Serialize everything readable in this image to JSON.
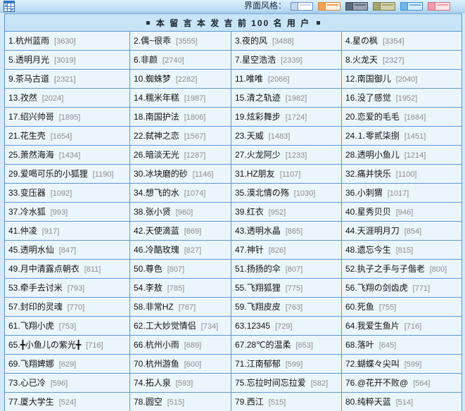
{
  "theme": {
    "page_bg": "#d4e9f8",
    "topbar_top": "#dff0fc",
    "topbar_bottom": "#b3d7f2",
    "topbar_line": "#8dbbe2",
    "grid": "#5b99d3",
    "header_bg": "#c8e4f6",
    "cell_bg": "#ebf5fc",
    "text": "#111111",
    "count": "#8c8c8c"
  },
  "topbar": {
    "icon": "window-grid-icon",
    "style_label": "界面风格：",
    "swatches": [
      {
        "border": "#6f8fbf",
        "a": "#c5d6ea",
        "b": "#ffffff"
      },
      {
        "border": "#d88a3c",
        "a": "#f6a150",
        "b": "#fdf0e2"
      },
      {
        "border": "#3f4a5a",
        "a": "#5e6a7c",
        "b": "#9aa3b2"
      },
      {
        "border": "#7f7d4e",
        "a": "#a6a46c",
        "b": "#d2d0a8"
      },
      {
        "border": "#3d8fd0",
        "a": "#6fb6e8",
        "b": "#d5ecfb"
      },
      {
        "border": "#d36b7c",
        "a": "#f29aa8",
        "b": "#fde6ea"
      }
    ]
  },
  "board": {
    "title": "本 留 言 本 发 言 前 100 名 用 户",
    "title_bullet_icon": "square-bullet-icon",
    "users": [
      {
        "rank": "1.",
        "name": "杭州蓝雨",
        "count": "[3630]"
      },
      {
        "rank": "2.",
        "name": "偶~很乖",
        "count": "[3555]"
      },
      {
        "rank": "3.",
        "name": "夜的风",
        "count": "[3488]"
      },
      {
        "rank": "4.",
        "name": "星の枫",
        "count": "[3354]"
      },
      {
        "rank": "5.",
        "name": "透明月光",
        "count": "[3019]"
      },
      {
        "rank": "6.",
        "name": "非颜",
        "count": "[2740]"
      },
      {
        "rank": "7.",
        "name": "星空浩浩",
        "count": "[2339]"
      },
      {
        "rank": "8.",
        "name": "火龙天",
        "count": "[2327]"
      },
      {
        "rank": "9.",
        "name": "茶马古道",
        "count": "[2321]"
      },
      {
        "rank": "10.",
        "name": "蜘蛛梦",
        "count": "[2282]"
      },
      {
        "rank": "11.",
        "name": "唯唯",
        "count": "[2066]"
      },
      {
        "rank": "12.",
        "name": "南国御儿",
        "count": "[2040]"
      },
      {
        "rank": "13.",
        "name": "孜然",
        "count": "[2024]"
      },
      {
        "rank": "14.",
        "name": "糯米年糕",
        "count": "[1987]"
      },
      {
        "rank": "15.",
        "name": "清之轨迹",
        "count": "[1982]"
      },
      {
        "rank": "16.",
        "name": "没了感觉",
        "count": "[1952]"
      },
      {
        "rank": "17.",
        "name": "绍兴帅哥",
        "count": "[1895]"
      },
      {
        "rank": "18.",
        "name": "南国护法",
        "count": "[1806]"
      },
      {
        "rank": "19.",
        "name": "炫彩舞步",
        "count": "[1724]"
      },
      {
        "rank": "20.",
        "name": "恋爱的毛毛",
        "count": "[1684]"
      },
      {
        "rank": "21.",
        "name": "花生壳",
        "count": "[1654]"
      },
      {
        "rank": "22.",
        "name": "弑神之恋",
        "count": "[1567]"
      },
      {
        "rank": "23.",
        "name": "天威",
        "count": "[1483]"
      },
      {
        "rank": "24.",
        "name": "⒈零贰柒捌",
        "count": "[1451]"
      },
      {
        "rank": "25.",
        "name": "萧然海海",
        "count": "[1434]"
      },
      {
        "rank": "26.",
        "name": "暗淡无光",
        "count": "[1287]"
      },
      {
        "rank": "27.",
        "name": "火龙阿少",
        "count": "[1233]"
      },
      {
        "rank": "28.",
        "name": "透明小鱼儿",
        "count": "[1214]"
      },
      {
        "rank": "29.",
        "name": "爱喝可乐的小狐狸",
        "count": "[1190]"
      },
      {
        "rank": "30.",
        "name": "冰块磨的砂",
        "count": "[1146]"
      },
      {
        "rank": "31.",
        "name": "HZ朋友",
        "count": "[1107]"
      },
      {
        "rank": "32.",
        "name": "痛并快乐",
        "count": "[1100]"
      },
      {
        "rank": "33.",
        "name": "变压器",
        "count": "[1092]"
      },
      {
        "rank": "34.",
        "name": "想飞的水",
        "count": "[1074]"
      },
      {
        "rank": "35.",
        "name": "漠北情の殇",
        "count": "[1030]"
      },
      {
        "rank": "36.",
        "name": "小刺猬",
        "count": "[1017]"
      },
      {
        "rank": "37.",
        "name": "冷水狐",
        "count": "[993]"
      },
      {
        "rank": "38.",
        "name": "张小贤",
        "count": "[960]"
      },
      {
        "rank": "39.",
        "name": "红衣",
        "count": "[952]"
      },
      {
        "rank": "40.",
        "name": "星秀贝贝",
        "count": "[946]"
      },
      {
        "rank": "41.",
        "name": "仲凌",
        "count": "[917]"
      },
      {
        "rank": "42.",
        "name": "天使滴蓝",
        "count": "[869]"
      },
      {
        "rank": "43.",
        "name": "透明水晶",
        "count": "[865]"
      },
      {
        "rank": "44.",
        "name": "天涯明月刀",
        "count": "[854]"
      },
      {
        "rank": "45.",
        "name": "透明水仙",
        "count": "[847]"
      },
      {
        "rank": "46.",
        "name": "冷酷玫瑰",
        "count": "[827]"
      },
      {
        "rank": "47.",
        "name": "神针",
        "count": "[826]"
      },
      {
        "rank": "48.",
        "name": "遗忘今生",
        "count": "[815]"
      },
      {
        "rank": "49.",
        "name": "月中清露点朝衣",
        "count": "[811]"
      },
      {
        "rank": "50.",
        "name": "尊色",
        "count": "[807]"
      },
      {
        "rank": "51.",
        "name": "扬扬的伞",
        "count": "[807]"
      },
      {
        "rank": "52.",
        "name": "执子之手与子偕老",
        "count": "[800]"
      },
      {
        "rank": "53.",
        "name": "牵手去讨米",
        "count": "[793]"
      },
      {
        "rank": "54.",
        "name": "李敖",
        "count": "[785]"
      },
      {
        "rank": "55.",
        "name": "飞翔狐狸",
        "count": "[775]"
      },
      {
        "rank": "56.",
        "name": "飞翔の剑齿虎",
        "count": "[771]"
      },
      {
        "rank": "57.",
        "name": "封印的灵魂",
        "count": "[770]"
      },
      {
        "rank": "58.",
        "name": "非常HZ",
        "count": "[767]"
      },
      {
        "rank": "59.",
        "name": "飞翔皮皮",
        "count": "[763]"
      },
      {
        "rank": "60.",
        "name": "死鱼",
        "count": "[755]"
      },
      {
        "rank": "61.",
        "name": "飞翔小虎",
        "count": "[753]"
      },
      {
        "rank": "62.",
        "name": "工大妙觉情侣",
        "count": "[734]"
      },
      {
        "rank": "63.",
        "name": "12345",
        "count": "[729]"
      },
      {
        "rank": "64.",
        "name": "我爱生鱼片",
        "count": "[716]"
      },
      {
        "rank": "65.",
        "name": "╋小鱼儿の紫光╋",
        "count": "[716]"
      },
      {
        "rank": "66.",
        "name": "杭州小雨",
        "count": "[689]"
      },
      {
        "rank": "67.",
        "name": "28℃的温柔",
        "count": "[653]"
      },
      {
        "rank": "68.",
        "name": "落叶",
        "count": "[645]"
      },
      {
        "rank": "69.",
        "name": "飞翔婢娜",
        "count": "[629]"
      },
      {
        "rank": "70.",
        "name": "杭州游鱼",
        "count": "[600]"
      },
      {
        "rank": "71.",
        "name": "江南郁郁",
        "count": "[599]"
      },
      {
        "rank": "72.",
        "name": "蝴蝶々尖叫",
        "count": "[599]"
      },
      {
        "rank": "73.",
        "name": "心已冷",
        "count": "[596]"
      },
      {
        "rank": "74.",
        "name": "拓人泉",
        "count": "[593]"
      },
      {
        "rank": "75.",
        "name": "忘拉时间忘拉爱",
        "count": "[582]"
      },
      {
        "rank": "76.",
        "name": "@花开不败@",
        "count": "[564]"
      },
      {
        "rank": "77.",
        "name": "厦大学生",
        "count": "[524]"
      },
      {
        "rank": "78.",
        "name": "圆空",
        "count": "[515]"
      },
      {
        "rank": "79.",
        "name": "西江",
        "count": "[515]"
      },
      {
        "rank": "80.",
        "name": "纯粹天蓝",
        "count": "[514]"
      }
    ]
  }
}
